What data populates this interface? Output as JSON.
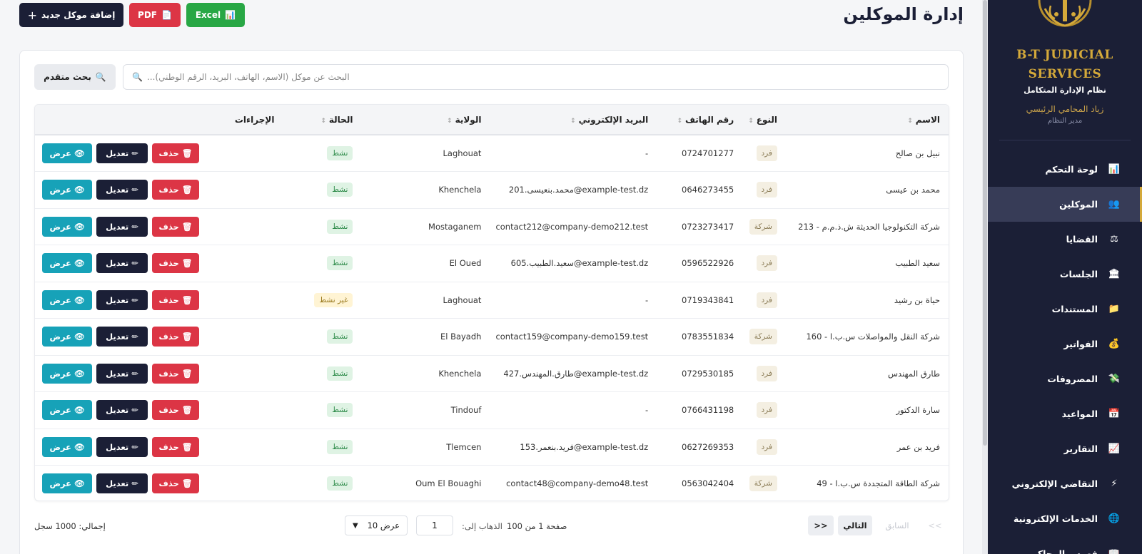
{
  "header": {
    "title": "إدارة الموكلين",
    "add_button": "إضافة موكل جديد",
    "pdf_button": "PDF",
    "excel_button": "Excel"
  },
  "search": {
    "placeholder": "البحث عن موكل (الاسم، الهاتف، البريد، الرقم الوطني)...",
    "advanced_button": "بحث متقدم"
  },
  "table": {
    "columns": [
      "الاسم",
      "النوع",
      "رقم الهاتف",
      "البريد الإلكتروني",
      "الولاية",
      "الحالة",
      "الإجراءات"
    ],
    "rows": [
      {
        "name": "نبيل بن صالح",
        "type": "فرد",
        "phone": "0724701277",
        "email": "-",
        "wilaya": "Laghouat",
        "status": "نشط"
      },
      {
        "name": "محمد بن عيسى",
        "type": "فرد",
        "phone": "0646273455",
        "email": "محمد.بنعيسى.201@example-test.dz",
        "wilaya": "Khenchela",
        "status": "نشط"
      },
      {
        "name": "شركة التكنولوجيا الحديثة ش.ذ.م.م - 213",
        "type": "شركة",
        "phone": "0723273417",
        "email": "contact212@company-demo212.test",
        "wilaya": "Mostaganem",
        "status": "نشط"
      },
      {
        "name": "سعيد الطبيب",
        "type": "فرد",
        "phone": "0596522926",
        "email": "سعيد.الطبيب.605@example-test.dz",
        "wilaya": "El Oued",
        "status": "نشط"
      },
      {
        "name": "حياة بن رشيد",
        "type": "فرد",
        "phone": "0719343841",
        "email": "-",
        "wilaya": "Laghouat",
        "status": "غير نشط"
      },
      {
        "name": "شركة النقل والمواصلات س.ب.ا - 160",
        "type": "شركة",
        "phone": "0783551834",
        "email": "contact159@company-demo159.test",
        "wilaya": "El Bayadh",
        "status": "نشط"
      },
      {
        "name": "طارق المهندس",
        "type": "فرد",
        "phone": "0729530185",
        "email": "طارق.المهندس.427@example-test.dz",
        "wilaya": "Khenchela",
        "status": "نشط"
      },
      {
        "name": "سارة الدكتور",
        "type": "فرد",
        "phone": "0766431198",
        "email": "-",
        "wilaya": "Tindouf",
        "status": "نشط"
      },
      {
        "name": "فريد بن عمر",
        "type": "فرد",
        "phone": "0627269353",
        "email": "فريد.بنعمر.153@example-test.dz",
        "wilaya": "Tlemcen",
        "status": "نشط"
      },
      {
        "name": "شركة الطاقة المتجددة س.ب.ا - 49",
        "type": "شركة",
        "phone": "0563042404",
        "email": "contact48@company-demo48.test",
        "wilaya": "Oum El Bouaghi",
        "status": "نشط"
      }
    ],
    "actions": {
      "view": "عرض",
      "edit": "تعديل",
      "delete": "حذف"
    }
  },
  "pagination": {
    "total": "إجمالي: 1000 سجل",
    "per_page": "عرض 10",
    "goto_label": "الذهاب إلى:",
    "goto_value": "1",
    "page_info": "صفحة 1 من 100",
    "next": "التالي",
    "prev": "السابق",
    "last": ">>",
    "first": "<<"
  },
  "sidebar": {
    "brand_line1": "B-T JUDICIAL",
    "brand_line2": "SERVICES",
    "subtitle": "نظام الإدارة المتكامل",
    "user_name": "زياد المحامي الرئيسي",
    "user_role": "مدير النظام",
    "items": [
      {
        "label": "لوحة التحكم",
        "icon": "chart-icon",
        "glyph": "📊",
        "active": false
      },
      {
        "label": "الموكلين",
        "icon": "users-icon",
        "glyph": "👥",
        "active": true
      },
      {
        "label": "القضايا",
        "icon": "scales-icon",
        "glyph": "⚖",
        "active": false
      },
      {
        "label": "الجلسات",
        "icon": "courthouse-icon",
        "glyph": "🏛",
        "active": false
      },
      {
        "label": "المستندات",
        "icon": "folder-icon",
        "glyph": "📁",
        "active": false
      },
      {
        "label": "الفواتير",
        "icon": "money-bag-icon",
        "glyph": "💰",
        "active": false
      },
      {
        "label": "المصروفات",
        "icon": "money-icon",
        "glyph": "💸",
        "active": false
      },
      {
        "label": "المواعيد",
        "icon": "calendar-icon",
        "glyph": "📅",
        "active": false
      },
      {
        "label": "التقارير",
        "icon": "trend-icon",
        "glyph": "📈",
        "active": false
      },
      {
        "label": "التقاضي الإلكتروني",
        "icon": "lightning-icon",
        "glyph": "⚡",
        "active": false
      },
      {
        "label": "الخدمات الإلكترونية",
        "icon": "globe-icon",
        "glyph": "🌐",
        "active": false
      },
      {
        "label": "فهرس المحاكم",
        "icon": "book-icon",
        "glyph": "📖",
        "active": false
      }
    ]
  },
  "colors": {
    "primary_dark": "#1b1f36",
    "accent_gold": "#d4a93a",
    "danger": "#dc3545",
    "success": "#28a745",
    "info": "#17a2b8"
  }
}
